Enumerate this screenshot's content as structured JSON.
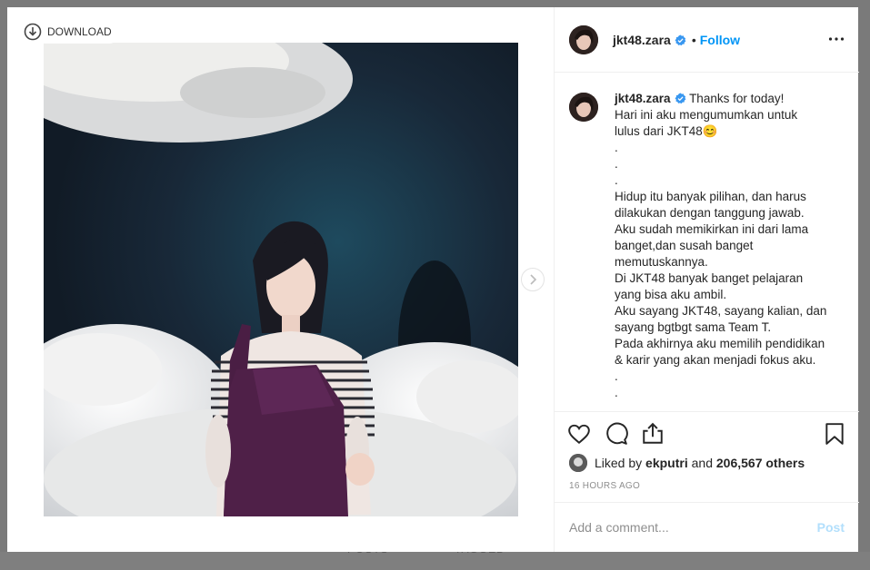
{
  "background": {
    "tabs": [
      "POSTS",
      "TAGGED"
    ]
  },
  "media": {
    "download_label": "DOWNLOAD",
    "download_icon": "download-circle-icon",
    "next_icon": "chevron-right-icon"
  },
  "header": {
    "username": "jkt48.zara",
    "separator": "•",
    "follow_label": "Follow",
    "verified_icon": "verified-badge-icon",
    "more_icon": "more-options-icon"
  },
  "caption": {
    "username": "jkt48.zara",
    "first_line": "Thanks for today!",
    "lines": [
      "Hari ini aku mengumumkan untuk",
      "lulus dari JKT48😊",
      ".",
      ".",
      ".",
      "Hidup itu banyak pilihan, dan harus",
      "dilakukan dengan tanggung jawab.",
      "Aku sudah memikirkan ini dari lama",
      "banget,dan susah banget",
      "memutuskannya.",
      "Di JKT48 banyak banget pelajaran",
      "yang bisa aku ambil.",
      "Aku sayang JKT48, sayang kalian, dan",
      "sayang bgtbgt sama Team T.",
      "Pada akhirnya aku memilih pendidikan",
      "& karir yang akan menjadi fokus aku.",
      ".",
      "."
    ]
  },
  "actions": {
    "like_icon": "heart-icon",
    "comment_icon": "comment-icon",
    "share_icon": "share-icon",
    "save_icon": "bookmark-icon"
  },
  "likes": {
    "prefix": "Liked by",
    "user": "ekputri",
    "and": "and",
    "count": "206,567 others"
  },
  "timestamp": "16 HOURS AGO",
  "comment": {
    "placeholder": "Add a comment...",
    "post_label": "Post"
  },
  "colors": {
    "accent": "#0095f6",
    "post_disabled": "#b2dffc",
    "verified": "#3897f0"
  }
}
